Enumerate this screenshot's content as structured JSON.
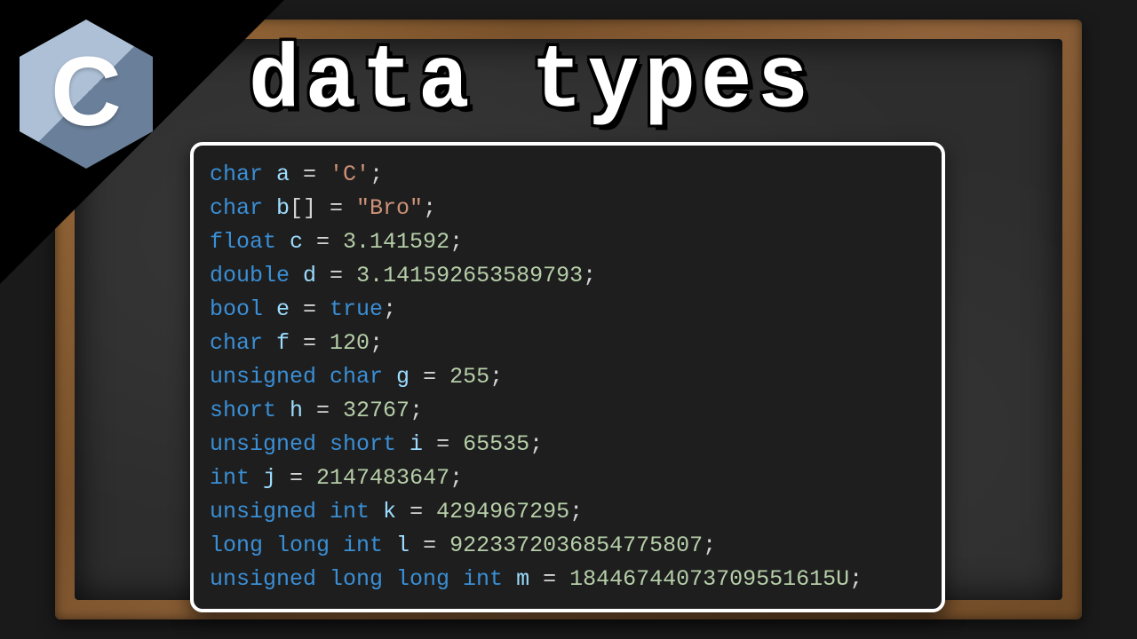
{
  "title": "data types",
  "logo_letter": "C",
  "code": [
    [
      {
        "t": "char ",
        "c": "kw"
      },
      {
        "t": "a",
        "c": "var"
      },
      {
        "t": " = ",
        "c": "op"
      },
      {
        "t": "'C'",
        "c": "str"
      },
      {
        "t": ";",
        "c": "op"
      }
    ],
    [
      {
        "t": "char ",
        "c": "kw"
      },
      {
        "t": "b",
        "c": "var"
      },
      {
        "t": "[] = ",
        "c": "op"
      },
      {
        "t": "\"Bro\"",
        "c": "str"
      },
      {
        "t": ";",
        "c": "op"
      }
    ],
    [
      {
        "t": "float ",
        "c": "kw"
      },
      {
        "t": "c",
        "c": "var"
      },
      {
        "t": " = ",
        "c": "op"
      },
      {
        "t": "3.141592",
        "c": "num"
      },
      {
        "t": ";",
        "c": "op"
      }
    ],
    [
      {
        "t": "double ",
        "c": "kw"
      },
      {
        "t": "d",
        "c": "var"
      },
      {
        "t": " = ",
        "c": "op"
      },
      {
        "t": "3.141592653589793",
        "c": "num"
      },
      {
        "t": ";",
        "c": "op"
      }
    ],
    [
      {
        "t": "bool ",
        "c": "kw"
      },
      {
        "t": "e",
        "c": "var"
      },
      {
        "t": " = ",
        "c": "op"
      },
      {
        "t": "true",
        "c": "bool"
      },
      {
        "t": ";",
        "c": "op"
      }
    ],
    [
      {
        "t": "char ",
        "c": "kw"
      },
      {
        "t": "f",
        "c": "var"
      },
      {
        "t": " = ",
        "c": "op"
      },
      {
        "t": "120",
        "c": "num"
      },
      {
        "t": ";",
        "c": "op"
      }
    ],
    [
      {
        "t": "unsigned char ",
        "c": "kw"
      },
      {
        "t": "g",
        "c": "var"
      },
      {
        "t": " = ",
        "c": "op"
      },
      {
        "t": "255",
        "c": "num"
      },
      {
        "t": ";",
        "c": "op"
      }
    ],
    [
      {
        "t": "short ",
        "c": "kw"
      },
      {
        "t": "h",
        "c": "var"
      },
      {
        "t": " = ",
        "c": "op"
      },
      {
        "t": "32767",
        "c": "num"
      },
      {
        "t": ";",
        "c": "op"
      }
    ],
    [
      {
        "t": "unsigned short ",
        "c": "kw"
      },
      {
        "t": "i",
        "c": "var"
      },
      {
        "t": " = ",
        "c": "op"
      },
      {
        "t": "65535",
        "c": "num"
      },
      {
        "t": ";",
        "c": "op"
      }
    ],
    [
      {
        "t": "int ",
        "c": "kw"
      },
      {
        "t": "j",
        "c": "var"
      },
      {
        "t": " = ",
        "c": "op"
      },
      {
        "t": "2147483647",
        "c": "num"
      },
      {
        "t": ";",
        "c": "op"
      }
    ],
    [
      {
        "t": "unsigned int ",
        "c": "kw"
      },
      {
        "t": "k",
        "c": "var"
      },
      {
        "t": " = ",
        "c": "op"
      },
      {
        "t": "4294967295",
        "c": "num"
      },
      {
        "t": ";",
        "c": "op"
      }
    ],
    [
      {
        "t": "long long int ",
        "c": "kw"
      },
      {
        "t": "l",
        "c": "var"
      },
      {
        "t": " = ",
        "c": "op"
      },
      {
        "t": "9223372036854775807",
        "c": "num"
      },
      {
        "t": ";",
        "c": "op"
      }
    ],
    [
      {
        "t": "unsigned long long int ",
        "c": "kw"
      },
      {
        "t": "m",
        "c": "var"
      },
      {
        "t": " = ",
        "c": "op"
      },
      {
        "t": "18446744073709551615U",
        "c": "num"
      },
      {
        "t": ";",
        "c": "op"
      }
    ]
  ]
}
